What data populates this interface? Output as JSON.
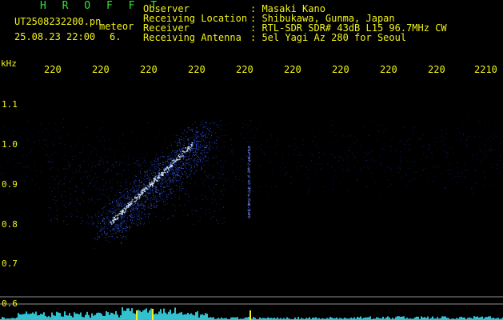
{
  "header": {
    "program": "H R O F F T",
    "filename": "UT2508232200.pn",
    "kind": "meteor",
    "datetime": "25.08.23 22:00",
    "count": "6."
  },
  "meta": [
    {
      "label": "Observer",
      "value": ": Masaki Kano"
    },
    {
      "label": "Receiving Location",
      "value": ": Shibukawa, Gunma, Japan"
    },
    {
      "label": "Receiver",
      "value": ": RTL-SDR SDR# 43dB L15 96.7MHz CW"
    },
    {
      "label": "Receiving Antenna",
      "value": ": 5el Yagi Az 280 for Seoul"
    }
  ],
  "axis": {
    "y_unit": "kHz",
    "y_ticks": [
      "1.1",
      "1.0",
      "0.9",
      "0.8",
      "0.7",
      "0.6"
    ],
    "x_ticks": [
      "220",
      "220",
      "220",
      "220",
      "220",
      "220",
      "220",
      "220",
      "220",
      "2210"
    ]
  },
  "colors": {
    "background": "#000000",
    "text_green": "#2ee62e",
    "text_yellow": "#f2f21a",
    "signal": "#3a5cff",
    "signal_core": "#cfe6ff",
    "spectrum": "#36d6e6",
    "guide_line": "#9a9a9a"
  }
}
